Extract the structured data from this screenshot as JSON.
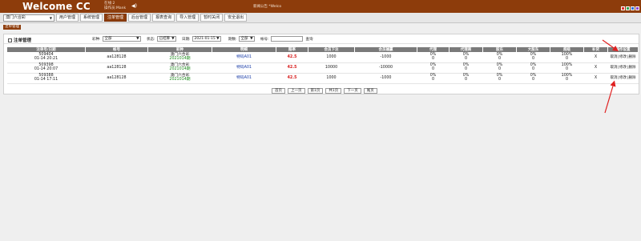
{
  "header": {
    "brand": "Welcome CC",
    "user_line1": "在线:2",
    "user_line2": "操作员:Mank",
    "marquee": "新闻公告 *Welco",
    "colors": {
      "bar": "#8d3c0b",
      "btn_red": "#e03030",
      "btn_green": "#2ea44f",
      "btn_blue": "#2a6fd6",
      "btn_purple": "#8a3fd1"
    }
  },
  "nav": {
    "lottery": "澳门六合彩",
    "tabs": [
      "用户管理",
      "系统管理",
      "注单管理",
      "后台管理",
      "报表查询",
      "导入管理",
      "暂时关闭",
      "安全退出"
    ],
    "active": "注单管理"
  },
  "breadcrumb": "注单管理",
  "panel": {
    "title": "注单管理",
    "filters": {
      "type_label": "彩种:",
      "type_value": "全部",
      "status_label": "状态:",
      "status_value": "已结算",
      "date_label": "日期:",
      "date_value": "2021-01-15",
      "period_label": "期数:",
      "period_value": "全部",
      "account_label": "帐号:",
      "account_value": "",
      "query": "查询"
    },
    "columns": [
      "注单号/日期",
      "帐号",
      "彩种",
      "明细",
      "赔率",
      "会员下注",
      "会员输赢",
      "代理",
      "代理商",
      "股东",
      "大股东",
      "超级",
      "补货",
      "操作设置"
    ],
    "rows": [
      {
        "order_no": "509404",
        "date": "01-14 20:21",
        "account": "aa128128",
        "lottery": "澳门六合彩",
        "period": "2021014期",
        "detail": "特码A01",
        "odds": "42.5",
        "bet": "1000",
        "winloss": "-1000",
        "agent": [
          "0%",
          "0"
        ],
        "agent_biz": [
          "0%",
          "0"
        ],
        "shareholder": [
          "0%",
          "0"
        ],
        "big_shareholder": [
          "0%",
          "0"
        ],
        "super": [
          "100%",
          "0"
        ],
        "refill": "X",
        "ops": [
          "取消",
          "修改",
          "删除"
        ]
      },
      {
        "order_no": "509398",
        "date": "01-14 20:07",
        "account": "aa128128",
        "lottery": "澳门六合彩",
        "period": "2021014期",
        "detail": "特码A01",
        "odds": "42.5",
        "bet": "10000",
        "winloss": "-10000",
        "agent": [
          "0%",
          "0"
        ],
        "agent_biz": [
          "0%",
          "0"
        ],
        "shareholder": [
          "0%",
          "0"
        ],
        "big_shareholder": [
          "0%",
          "0"
        ],
        "super": [
          "100%",
          "0"
        ],
        "refill": "X",
        "ops": [
          "取消",
          "修改",
          "删除"
        ]
      },
      {
        "order_no": "509388",
        "date": "01-14 17:11",
        "account": "aa128128",
        "lottery": "澳门六合彩",
        "period": "2021014期",
        "detail": "特码A01",
        "odds": "42.5",
        "bet": "1000",
        "winloss": "-1000",
        "agent": [
          "0%",
          "0"
        ],
        "agent_biz": [
          "0%",
          "0"
        ],
        "shareholder": [
          "0%",
          "0"
        ],
        "big_shareholder": [
          "0%",
          "0"
        ],
        "super": [
          "100%",
          "0"
        ],
        "refill": "X",
        "ops": [
          "取消",
          "修改",
          "删除"
        ]
      }
    ],
    "pager": [
      "首页",
      "上一页",
      "第1页",
      "共1页",
      "下一页",
      "尾页"
    ]
  }
}
